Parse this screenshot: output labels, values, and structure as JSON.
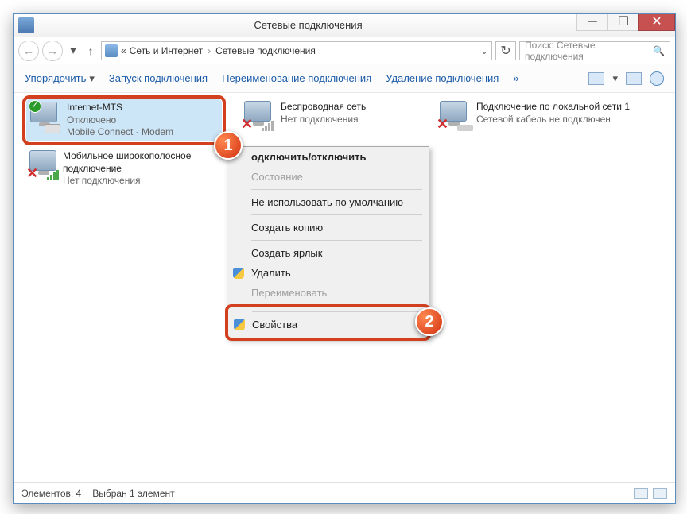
{
  "window": {
    "title": "Сетевые подключения"
  },
  "breadcrumb": {
    "prefix": "«",
    "item1": "Сеть и Интернет",
    "item2": "Сетевые подключения"
  },
  "search": {
    "placeholder": "Поиск: Сетевые подключения"
  },
  "toolbar": {
    "organize": "Упорядочить",
    "start": "Запуск подключения",
    "rename": "Переименование подключения",
    "delete": "Удаление подключения",
    "more": "»"
  },
  "connections": {
    "c1": {
      "name": "Internet-MTS",
      "status": "Отключено",
      "device": "Mobile Connect - Modem"
    },
    "c2": {
      "name": "Беспроводная сеть",
      "status": "Нет подключения"
    },
    "c3": {
      "name": "Подключение по локальной сети 1",
      "status": "Сетевой кабель не подключен"
    },
    "c4": {
      "name": "Мобильное широкополосное подключение",
      "status": "Нет подключения"
    }
  },
  "contextmenu": {
    "connect": "одключить/отключить",
    "state": "Состояние",
    "nodefault": "Не использовать по умолчанию",
    "copy": "Создать копию",
    "shortcut": "Создать ярлык",
    "delete": "Удалить",
    "rename": "Переименовать",
    "properties": "Свойства"
  },
  "callouts": {
    "one": "1",
    "two": "2"
  },
  "status": {
    "count": "Элементов: 4",
    "selected": "Выбран 1 элемент"
  }
}
